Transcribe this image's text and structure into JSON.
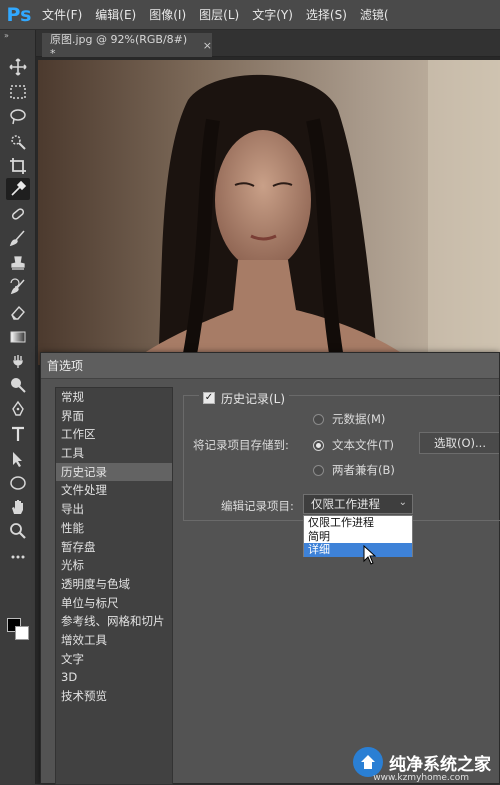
{
  "app": {
    "logo_text": "Ps",
    "accent": "#31a8ff"
  },
  "menubar": {
    "items": [
      "文件(F)",
      "编辑(E)",
      "图像(I)",
      "图层(L)",
      "文字(Y)",
      "选择(S)",
      "滤镜("
    ]
  },
  "toolbar": {
    "collapse_glyph": "»",
    "tools": [
      {
        "icon": "move-tool-icon",
        "active": false
      },
      {
        "icon": "marquee-tool-icon",
        "active": false
      },
      {
        "icon": "lasso-tool-icon",
        "active": false
      },
      {
        "icon": "quick-select-tool-icon",
        "active": false
      },
      {
        "icon": "crop-tool-icon",
        "active": false
      },
      {
        "icon": "eyedropper-tool-icon",
        "active": true
      },
      {
        "icon": "healing-brush-tool-icon",
        "active": false
      },
      {
        "icon": "brush-tool-icon",
        "active": false
      },
      {
        "icon": "clone-stamp-tool-icon",
        "active": false
      },
      {
        "icon": "history-brush-tool-icon",
        "active": false
      },
      {
        "icon": "eraser-tool-icon",
        "active": false
      },
      {
        "icon": "gradient-tool-icon",
        "active": false
      },
      {
        "icon": "smudge-tool-icon",
        "active": false
      },
      {
        "icon": "dodge-tool-icon",
        "active": false
      },
      {
        "icon": "pen-tool-icon",
        "active": false
      },
      {
        "icon": "type-tool-icon",
        "active": false
      },
      {
        "icon": "path-select-tool-icon",
        "active": false
      },
      {
        "icon": "shape-tool-icon",
        "active": false
      },
      {
        "icon": "hand-tool-icon",
        "active": false
      },
      {
        "icon": "zoom-tool-icon",
        "active": false
      },
      {
        "icon": "more-tools-icon",
        "active": false
      }
    ]
  },
  "document": {
    "tab_title": "原图.jpg @ 92%(RGB/8#) *",
    "close_glyph": "×"
  },
  "prefs": {
    "title": "首选项",
    "categories": [
      "常规",
      "界面",
      "工作区",
      "工具",
      "历史记录",
      "文件处理",
      "导出",
      "性能",
      "暂存盘",
      "光标",
      "透明度与色域",
      "单位与标尺",
      "参考线、网格和切片",
      "增效工具",
      "文字",
      "3D",
      "技术预览"
    ],
    "selected_category": "历史记录",
    "history_checkbox_label": "历史记录(L)",
    "history_checked": true,
    "save_to_label": "将记录项目存储到:",
    "radio_options": [
      {
        "label": "元数据(M)",
        "checked": false
      },
      {
        "label": "文本文件(T)",
        "checked": true
      },
      {
        "label": "两者兼有(B)",
        "checked": false
      }
    ],
    "choose_button": "选取(O)...",
    "edit_items_label": "编辑记录项目:",
    "edit_items_value": "仅限工作进程",
    "dropdown_options": [
      "仅限工作进程",
      "简明",
      "详细"
    ],
    "dropdown_highlight": "详细"
  },
  "watermark": {
    "text": "纯净系统之家",
    "url": "www.kzmyhome.com"
  }
}
